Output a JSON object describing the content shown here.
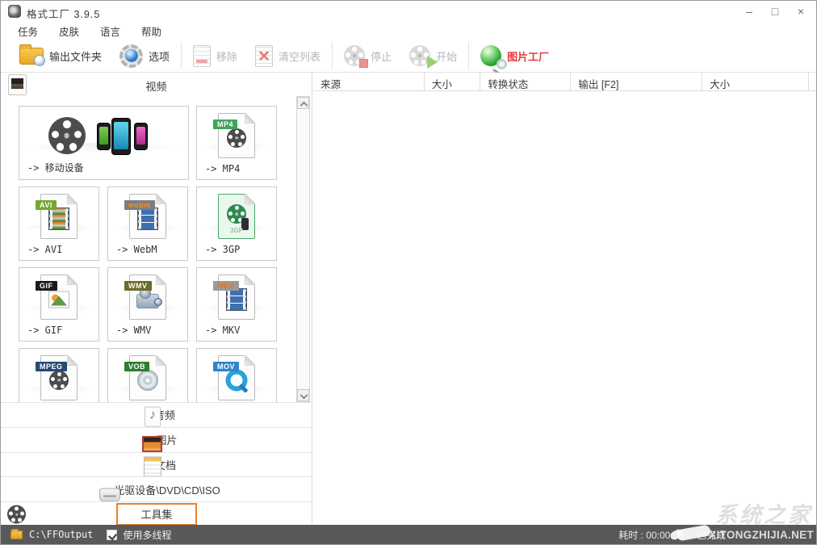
{
  "window": {
    "title": "格式工厂 3.9.5",
    "minimize_glyph": "–",
    "maximize_glyph": "□",
    "close_glyph": "×"
  },
  "menu": {
    "items": [
      {
        "label": "任务"
      },
      {
        "label": "皮肤"
      },
      {
        "label": "语言"
      },
      {
        "label": "帮助"
      }
    ]
  },
  "toolbar": {
    "output_folder": "输出文件夹",
    "options": "选项",
    "remove": "移除",
    "clear_list": "清空列表",
    "stop": "停止",
    "start": "开始",
    "picture_factory": "图片工厂",
    "picture_factory_color": "#e23b3b"
  },
  "left_panel": {
    "video_label": "视频",
    "tiles": [
      {
        "label": "-> 移动设备",
        "tag": ""
      },
      {
        "label": "-> MP4",
        "tag": "MP4",
        "tag_color": "#3fa45c"
      },
      {
        "label": "-> AVI",
        "tag": "AVI",
        "tag_color": "#76a72e"
      },
      {
        "label": "-> WebM",
        "tag": "webm",
        "tag_color": "#7d7d7d"
      },
      {
        "label": "-> 3GP",
        "tag": "3GP",
        "tag_color": "#3f9f5f"
      },
      {
        "label": "-> GIF",
        "tag": "GIF",
        "tag_color": "#1a1a1a"
      },
      {
        "label": "-> WMV",
        "tag": "WMV",
        "tag_color": "#6b6b2a"
      },
      {
        "label": "-> MKV",
        "tag": "MKV",
        "tag_color": "#9a9a9a"
      },
      {
        "label": "-> MPEG",
        "tag": "MPEG",
        "tag_color": "#274a73"
      },
      {
        "label": "-> VOB",
        "tag": "VOB",
        "tag_color": "#2e7d32"
      },
      {
        "label": "-> MOV",
        "tag": "MOV",
        "tag_color": "#2e86c8"
      }
    ],
    "categories": [
      {
        "label": "音频"
      },
      {
        "label": "图片"
      },
      {
        "label": "文档"
      },
      {
        "label": "光驱设备\\DVD\\CD\\ISO"
      },
      {
        "label": "工具集",
        "highlighted": true,
        "highlight_color": "#e8822a"
      }
    ]
  },
  "table": {
    "columns": [
      {
        "label": "来源"
      },
      {
        "label": "大小"
      },
      {
        "label": "转换状态"
      },
      {
        "label": "输出 [F2]"
      },
      {
        "label": "大小"
      }
    ]
  },
  "status_bar": {
    "output_path": "C:\\FFOutput",
    "multithread_label": "使用多线程",
    "checkbox_checked": true,
    "elapsed": "耗时 : 00:00:00",
    "done": "已完成"
  },
  "watermark": {
    "site_cn": "系统之家",
    "site_en": "XITONGZHIJIA.NET"
  }
}
